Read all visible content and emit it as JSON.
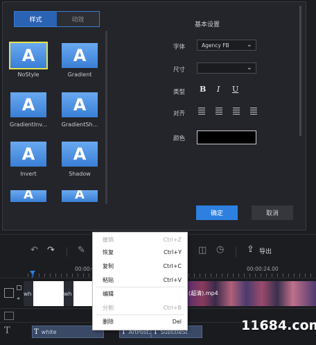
{
  "tabs": {
    "style_label": "样式",
    "animation_label": "动效"
  },
  "styles": [
    {
      "glyph": "A",
      "label": "NoStyle"
    },
    {
      "glyph": "A",
      "label": "Gradient"
    },
    {
      "glyph": "A",
      "label": "GradientInv..."
    },
    {
      "glyph": "A",
      "label": "GradientSh..."
    },
    {
      "glyph": "A",
      "label": "Invert"
    },
    {
      "glyph": "A",
      "label": "Shadow"
    },
    {
      "glyph": "A",
      "label": ""
    },
    {
      "glyph": "A",
      "label": ""
    }
  ],
  "settings": {
    "title": "基本设置",
    "font_label": "字体",
    "font_value": "Agency FB",
    "size_label": "尺寸",
    "size_value": "",
    "type_label": "类型",
    "bold": "B",
    "italic": "I",
    "underline": "U",
    "align_label": "对齐",
    "color_label": "颜色",
    "color_value": "#000000"
  },
  "dialog_buttons": {
    "ok": "确定",
    "cancel": "取消"
  },
  "toolbar": {
    "export_label": "导出"
  },
  "ruler": {
    "time_left": "00:00:0",
    "time_right": "00:00:24.00"
  },
  "tracks": {
    "video_clip_label_1": "wh",
    "video_clip_label_2": "wh",
    "video_clip_overlay": "(超清).mp4",
    "text_clip_1": "white",
    "text_clip_2": "ArtPost3",
    "text_clip_3": "SubtitleSt",
    "text_glyph": "T"
  },
  "context_menu": [
    {
      "label": "撤销",
      "shortcut": "Ctrl+Z",
      "enabled": false
    },
    {
      "label": "恢复",
      "shortcut": "Ctrl+Y",
      "enabled": true
    },
    {
      "label": "复制",
      "shortcut": "Ctrl+C",
      "enabled": true
    },
    {
      "label": "粘贴",
      "shortcut": "Ctrl+V",
      "enabled": true
    },
    {
      "label": "编辑",
      "shortcut": "",
      "enabled": true
    },
    {
      "label": "分割",
      "shortcut": "Ctrl+B",
      "enabled": false
    },
    {
      "label": "删除",
      "shortcut": "Del",
      "enabled": true
    }
  ],
  "watermark": "11684.com",
  "colors": {
    "accent": "#2d7fe0",
    "selected_outline": "#e4e34a",
    "tile": "#4a8fe2"
  }
}
